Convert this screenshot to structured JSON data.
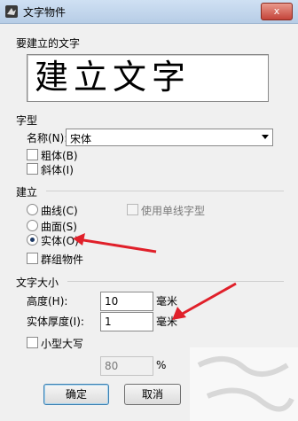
{
  "window": {
    "title": "文字物件",
    "close_label": "x"
  },
  "create_text": {
    "section_label": "要建立的文字",
    "content": "建立文字"
  },
  "font": {
    "section_label": "字型",
    "name_label": "名称(N):",
    "name_value": "宋体",
    "bold_label": "粗体(B)",
    "italic_label": "斜体(I)"
  },
  "build": {
    "section_label": "建立",
    "curve_label": "曲线(C)",
    "surface_label": "曲面(S)",
    "solid_label": "实体(O)",
    "group_label": "群组物件",
    "single_stroke_label": "使用单线字型",
    "selected_option": "solid"
  },
  "size": {
    "section_label": "文字大小",
    "height_label": "高度(H):",
    "height_value": "10",
    "height_unit": "毫米",
    "thickness_label": "实体厚度(I):",
    "thickness_value": "1",
    "thickness_unit": "毫米",
    "small_caps_label": "小型大写",
    "small_caps_value": "80",
    "small_caps_unit": "%"
  },
  "buttons": {
    "ok_label": "确定",
    "cancel_label": "取消"
  },
  "colors": {
    "arrow": "#e0202a",
    "selected_radio": "#1e3a66"
  },
  "icons": [
    "app-icon",
    "chevron-down-icon",
    "close-icon"
  ]
}
